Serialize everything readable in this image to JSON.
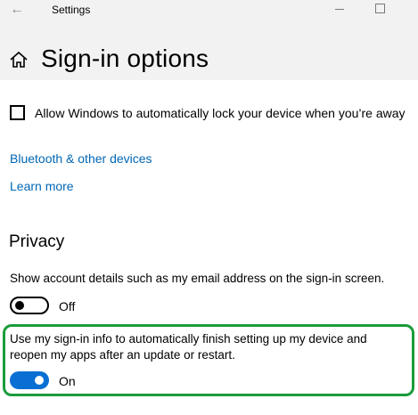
{
  "window": {
    "title": "Settings",
    "back_icon": "back-arrow-icon"
  },
  "page": {
    "title": "Sign-in options",
    "home_icon": "home-icon"
  },
  "lock": {
    "checkbox_label": "Allow Windows to automatically lock your device when you’re away",
    "checked": false
  },
  "links": {
    "bluetooth": "Bluetooth & other devices",
    "learn_more": "Learn more"
  },
  "privacy": {
    "title": "Privacy",
    "account_details": {
      "description": "Show account details such as my email address on the sign-in screen.",
      "state_label": "Off",
      "on": false
    },
    "signin_info": {
      "description": "Use my sign-in info to automatically finish setting up my device and reopen my apps after an update or restart.",
      "state_label": "On",
      "on": true
    }
  },
  "colors": {
    "accent": "#0a6fd3",
    "link": "#0066b4",
    "highlight_border": "#1a9c3b",
    "titlebar_bg": "#f2f2f2"
  }
}
